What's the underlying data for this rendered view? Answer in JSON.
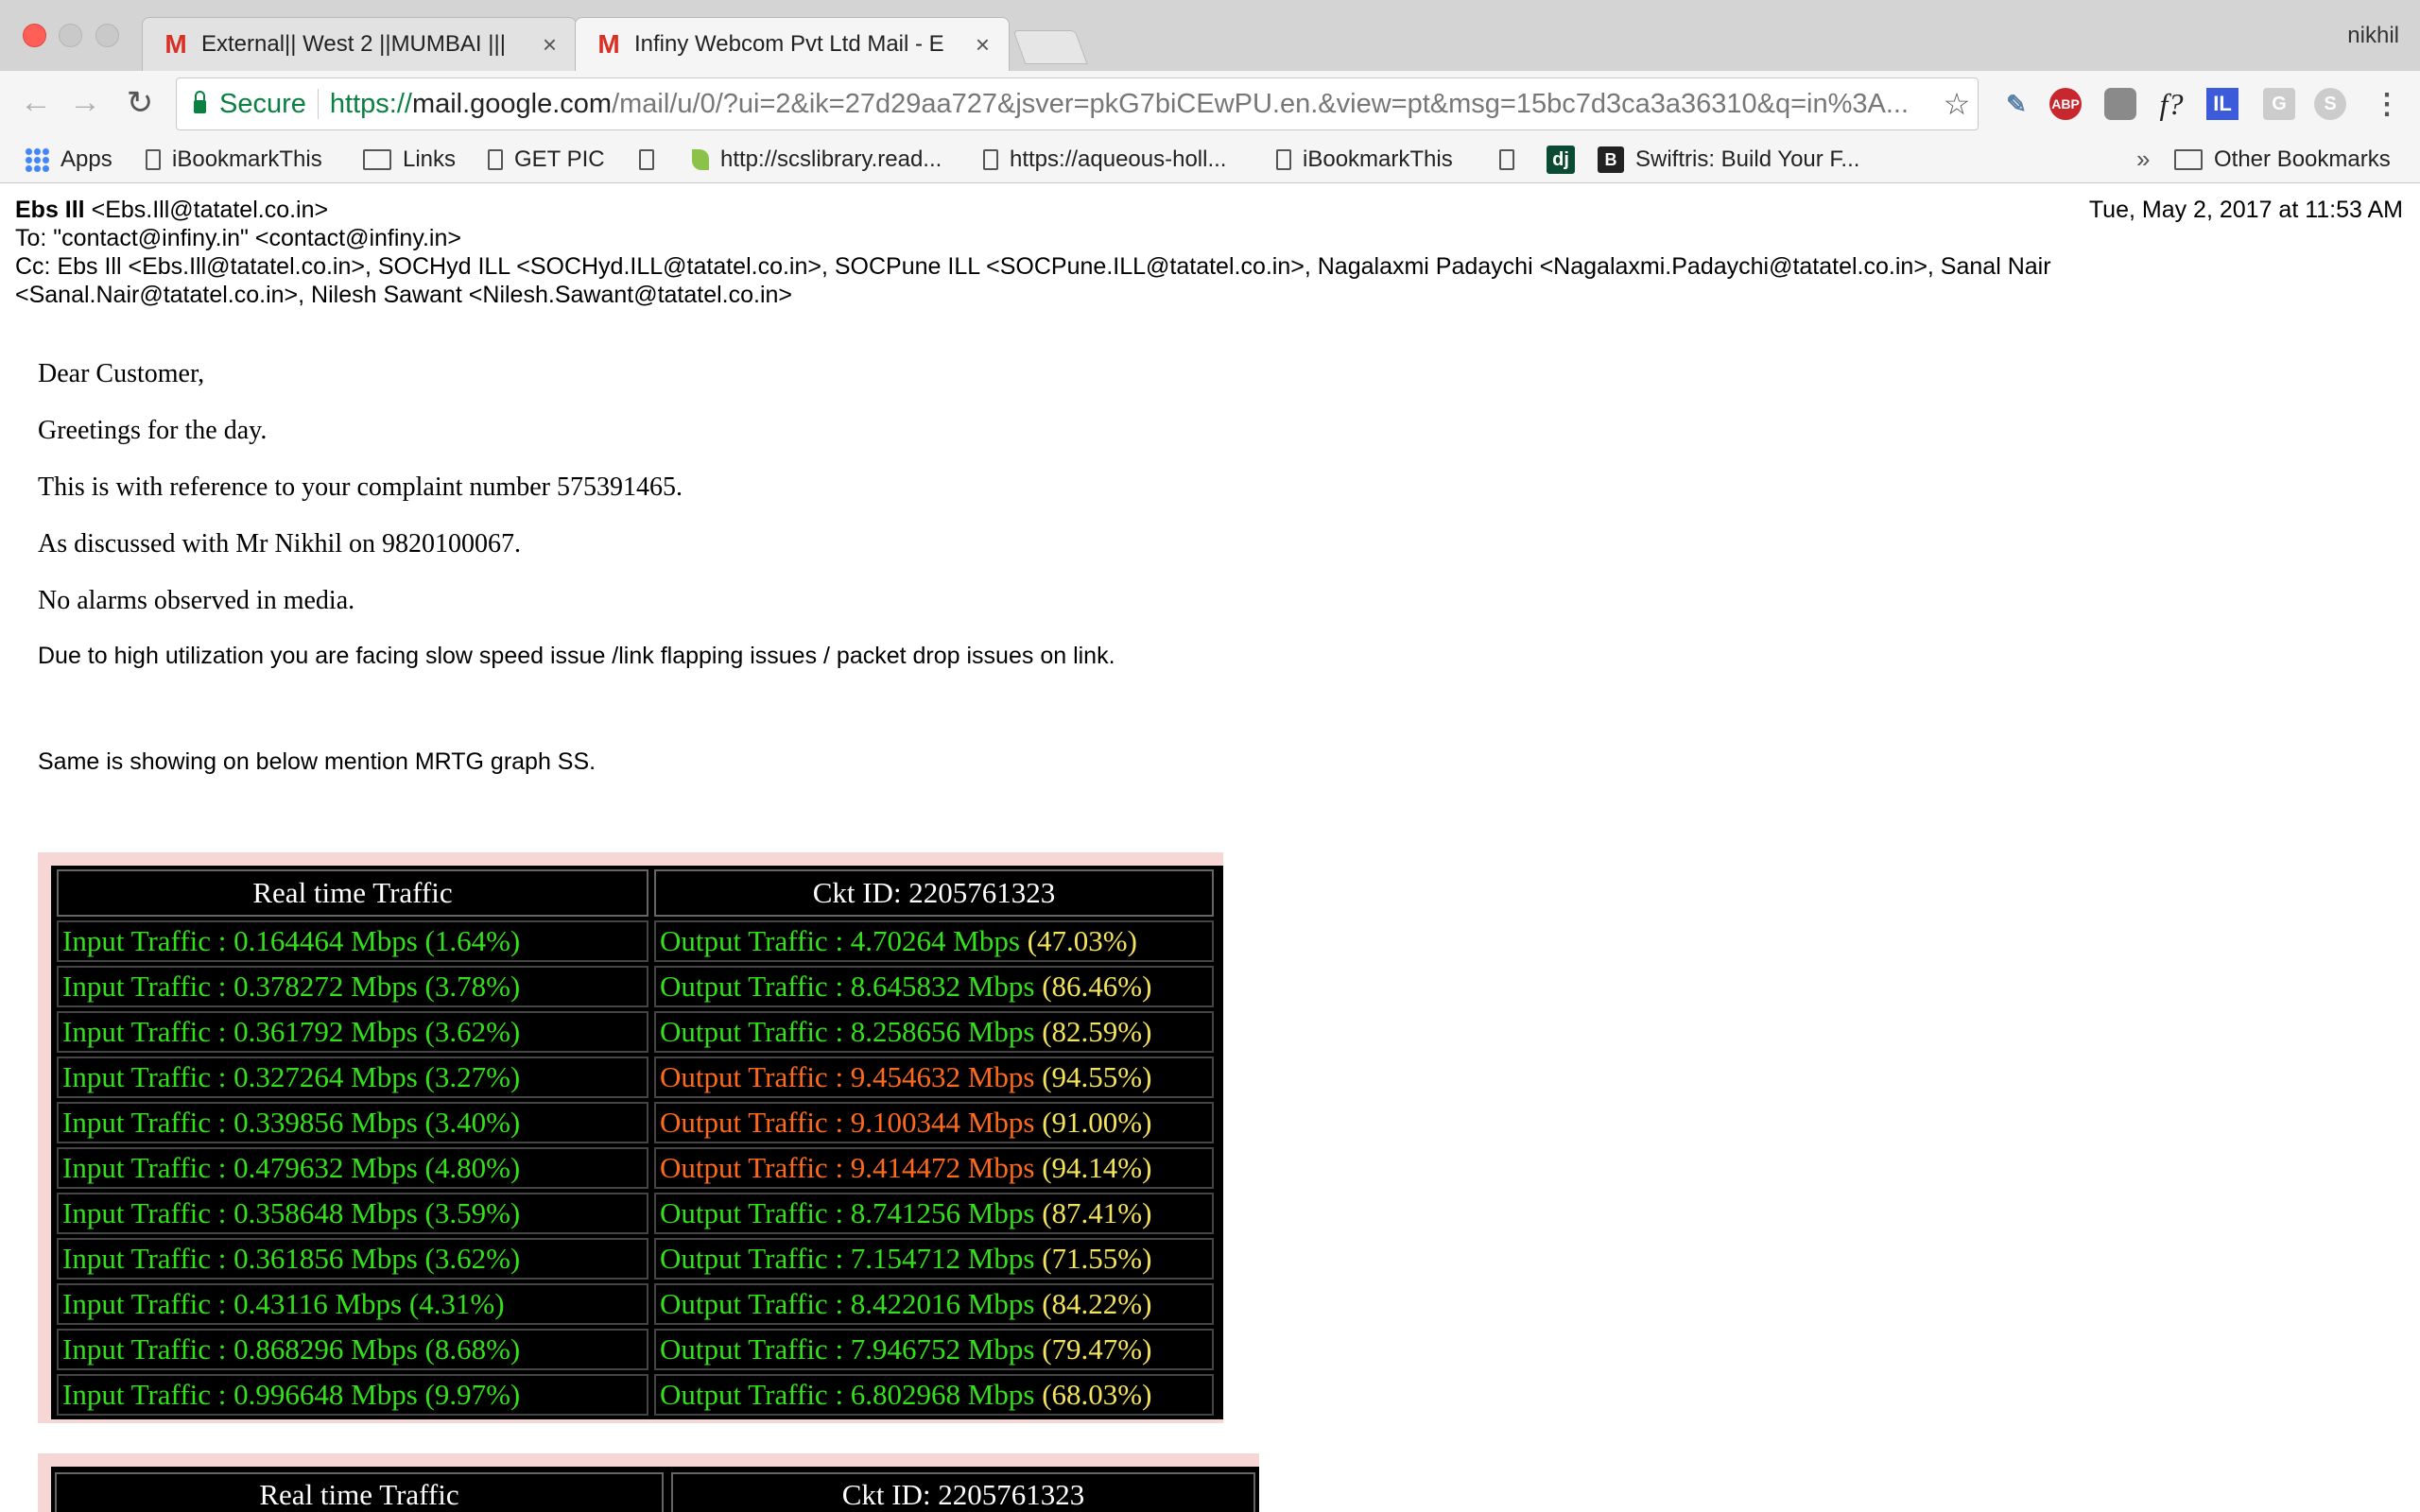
{
  "browser": {
    "tabs": [
      {
        "title": "External|| West 2 ||MUMBAI |||",
        "active": false
      },
      {
        "title": "Infiny Webcom Pvt Ltd Mail - E",
        "active": true
      }
    ],
    "profile_name": "nikhil",
    "secure_label": "Secure",
    "url": {
      "scheme": "https://",
      "host": "mail.google.com",
      "rest": "/mail/u/0/?ui=2&ik=27d29aa727&jsver=pkG7biCEwPU.en.&view=pt&msg=15bc7d3ca3a36310&q=in%3A..."
    },
    "bookmarks": [
      {
        "label": "Apps",
        "icon": "apps-icon"
      },
      {
        "label": "iBookmarkThis",
        "icon": "page-icon"
      },
      {
        "label": "Links",
        "icon": "folder-icon"
      },
      {
        "label": "GET PIC",
        "icon": "page-icon"
      },
      {
        "label": "",
        "icon": "page-icon"
      },
      {
        "label": "http://scslibrary.read...",
        "icon": "leaf-icon"
      },
      {
        "label": "https://aqueous-holl...",
        "icon": "page-icon"
      },
      {
        "label": "iBookmarkThis",
        "icon": "page-icon"
      },
      {
        "label": "",
        "icon": "page-icon"
      },
      {
        "label": "",
        "icon": "dj-icon"
      },
      {
        "label": "Swiftris: Build Your F...",
        "icon": "b-icon"
      },
      {
        "label": "Other Bookmarks",
        "icon": "folder-icon"
      }
    ],
    "overflow_chevron": "»",
    "extensions": {
      "abp": "ABP",
      "f": "f?",
      "il": "IL",
      "g": "G",
      "s": "S"
    }
  },
  "email": {
    "from_name": "Ebs Ill",
    "from_addr": "<Ebs.Ill@tatatel.co.in>",
    "date": "Tue, May 2, 2017 at 11:53 AM",
    "to": "To: \"contact@infiny.in\" <contact@infiny.in>",
    "cc_line1": "Cc: Ebs Ill <Ebs.Ill@tatatel.co.in>, SOCHyd ILL <SOCHyd.ILL@tatatel.co.in>, SOCPune ILL <SOCPune.ILL@tatatel.co.in>, Nagalaxmi Padaychi <Nagalaxmi.Padaychi@tatatel.co.in>, Sanal Nair",
    "cc_line2": "<Sanal.Nair@tatatel.co.in>, Nilesh Sawant <Nilesh.Sawant@tatatel.co.in>",
    "body": {
      "greeting": "Dear Customer,",
      "line1": "Greetings for the day.",
      "line2": "This is with reference to your complaint number 575391465.",
      "line3": "As discussed with Mr Nikhil on 9820100067.",
      "line4": "No alarms observed in media.",
      "line5": "Due to high utilization you are facing slow speed issue /link flapping issues / packet drop issues on link.",
      "line6": "Same is showing on below mention MRTG graph SS."
    },
    "mrtg": {
      "header_left": "Real time Traffic",
      "header_right": "Ckt ID: 2205761323",
      "rows": [
        {
          "in": "Input Traffic : 0.164464 Mbps (1.64%)",
          "out": "Output Traffic : 4.70264 Mbps ",
          "out_pct": "(47.03%)",
          "high": false
        },
        {
          "in": "Input Traffic : 0.378272 Mbps (3.78%)",
          "out": "Output Traffic : 8.645832 Mbps ",
          "out_pct": "(86.46%)",
          "high": false
        },
        {
          "in": "Input Traffic : 0.361792 Mbps (3.62%)",
          "out": "Output Traffic : 8.258656 Mbps ",
          "out_pct": "(82.59%)",
          "high": false
        },
        {
          "in": "Input Traffic : 0.327264 Mbps (3.27%)",
          "out": "Output Traffic : 9.454632 Mbps ",
          "out_pct": "(94.55%)",
          "high": true
        },
        {
          "in": "Input Traffic : 0.339856 Mbps (3.40%)",
          "out": "Output Traffic : 9.100344 Mbps ",
          "out_pct": "(91.00%)",
          "high": true
        },
        {
          "in": "Input Traffic : 0.479632 Mbps (4.80%)",
          "out": "Output Traffic : 9.414472 Mbps ",
          "out_pct": "(94.14%)",
          "high": true
        },
        {
          "in": "Input Traffic : 0.358648 Mbps (3.59%)",
          "out": "Output Traffic : 8.741256 Mbps ",
          "out_pct": "(87.41%)",
          "high": false
        },
        {
          "in": "Input Traffic : 0.361856 Mbps (3.62%)",
          "out": "Output Traffic : 7.154712 Mbps ",
          "out_pct": "(71.55%)",
          "high": false
        },
        {
          "in": "Input Traffic : 0.43116 Mbps (4.31%)",
          "out": "Output Traffic : 8.422016 Mbps ",
          "out_pct": "(84.22%)",
          "high": false
        },
        {
          "in": "Input Traffic : 0.868296 Mbps (8.68%)",
          "out": "Output Traffic : 7.946752 Mbps ",
          "out_pct": "(79.47%)",
          "high": false
        },
        {
          "in": "Input Traffic : 0.996648 Mbps (9.97%)",
          "out": "Output Traffic : 6.802968 Mbps ",
          "out_pct": "(68.03%)",
          "high": false
        }
      ]
    },
    "mrtg2": {
      "header_left": "Real time Traffic",
      "header_right": "Ckt ID: 2205761323"
    }
  }
}
